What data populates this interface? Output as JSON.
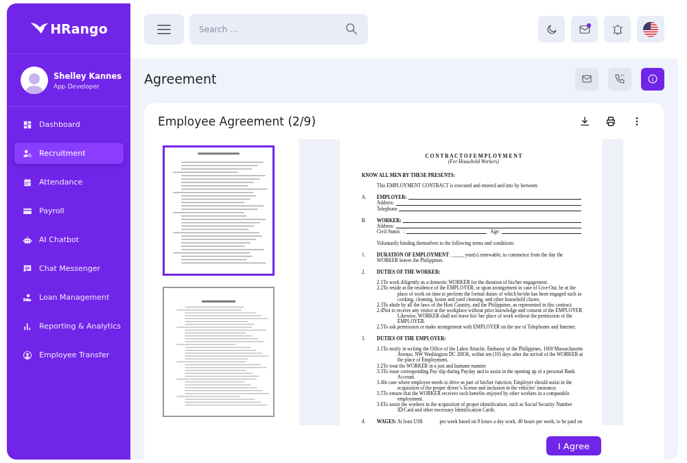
{
  "sidebar": {
    "logo": "HRango",
    "user": {
      "name": "Shelley Kannes",
      "role": "App Developer"
    },
    "items": [
      {
        "label": "Dashboard",
        "selected": false
      },
      {
        "label": "Recruitment",
        "selected": true
      },
      {
        "label": "Attendance",
        "selected": false
      },
      {
        "label": "Payroll",
        "selected": false
      },
      {
        "label": "AI Chatbot",
        "selected": false
      },
      {
        "label": "Chat Messenger",
        "selected": false
      },
      {
        "label": "Loan Management",
        "selected": false
      },
      {
        "label": "Reporting & Analytics",
        "selected": false
      },
      {
        "label": "Employee Transfer",
        "selected": false
      }
    ]
  },
  "header": {
    "search": {
      "placeholder": "Search ..."
    },
    "mail_unread": true
  },
  "page": {
    "title": "Agreement"
  },
  "card": {
    "title": "Employee Agreement (2/9)",
    "thumbnails": [
      {
        "selected": true,
        "kind": "contract"
      },
      {
        "selected": false,
        "kind": "project"
      }
    ],
    "document": [
      {
        "kind": "title",
        "text": "C O N T R A C T O F E M P L O Y M E N T"
      },
      {
        "kind": "subtitle",
        "text": "(For Household Workers)"
      },
      {
        "kind": "heading",
        "text": "KNOW ALL MEN BY THESE PRESENTS:"
      },
      {
        "kind": "para",
        "text": "This EMPLOYMENT CONTRACT is executed and entered and into by between:"
      },
      {
        "kind": "party",
        "num": "A.",
        "label": "EMPLOYER:",
        "rows": [
          [
            "Address:"
          ],
          [
            "Telephone"
          ]
        ]
      },
      {
        "kind": "party",
        "num": "B.",
        "label": "WORKER:",
        "rows": [
          [
            "Address:"
          ],
          [
            "Civil Status   :",
            "Age:"
          ]
        ]
      },
      {
        "kind": "para",
        "text": "Voluntarily binding themselves to the following terms and conditions:"
      },
      {
        "kind": "section",
        "num": "1.",
        "text": "**DURATION OF EMPLOYMENT**: _____ year(s) renewable; to commence from the day the WORKER leaves the Philippines."
      },
      {
        "kind": "section",
        "num": "2.",
        "heading": "DUTIES OF THE WORKER:",
        "items": [
          {
            "num": "2.1",
            "text": "To work diligently as a domestic WORKER for the duration of his/her engagement."
          },
          {
            "num": "2.2",
            "text": "To reside at the residence of the EMPLOYER, or upon arrangement in case of Live-Out, be at the place of work on time to perform the formal duties of which he/she has been engaged such as cooking, cleaning, house and yard cleaning, and other household chores."
          },
          {
            "num": "2.3",
            "text": "To abide by all the laws of the Host Country, and the Philippines, as represented in this contract."
          },
          {
            "num": "2.4",
            "text": "Not to receive any visitor at the workplace without prior knowledge and consent of the EMPLOYER. Likewise, WORKER shall not leave his/ her place of work without the permission of the EMPLOYER."
          },
          {
            "num": "2.5",
            "text": "To ask permission or make arrangement with EMPLOYER on the use of Telephones and Internet."
          }
        ]
      },
      {
        "kind": "section",
        "num": "3.",
        "heading": "DUTIES OF THE EMPLOYER:",
        "items": [
          {
            "num": "3.1",
            "text": "To notify in writing the Office of the Labor Attaché, Embassy of the Philippines, 1600 Massachusetts Avenue, NW Washington DC 20036, within ten (10) days after the arrival of the WORKER at the place of Employment."
          },
          {
            "num": "3.2",
            "text": "To treat the WORKER in a just and humane manner"
          },
          {
            "num": "3.3",
            "text": "To issue corresponding Pay slip during Payday and to assist in the opening up of a personal Bank Account."
          },
          {
            "num": "3.4",
            "text": "In case where employee needs to drive as part of his/her function, Employer should assist in the acquisition of the proper driver’s license and inclusion in the vehicles’ insurance."
          },
          {
            "num": "3.5",
            "text": "To ensure that the WORKER receives such benefits enjoyed by other workers in a comparable employment."
          },
          {
            "num": "3.6",
            "text": "To assist the workers in the acquisition of proper identification, such as Social Security Number ID/Card and other necessary Identification Cards."
          }
        ]
      },
      {
        "kind": "section",
        "num": "4.",
        "text": "**WAGES:** At least US$              per week based on 8 hours a day work, 40 hours per week; to be paid on"
      }
    ],
    "button": "I Agree"
  }
}
